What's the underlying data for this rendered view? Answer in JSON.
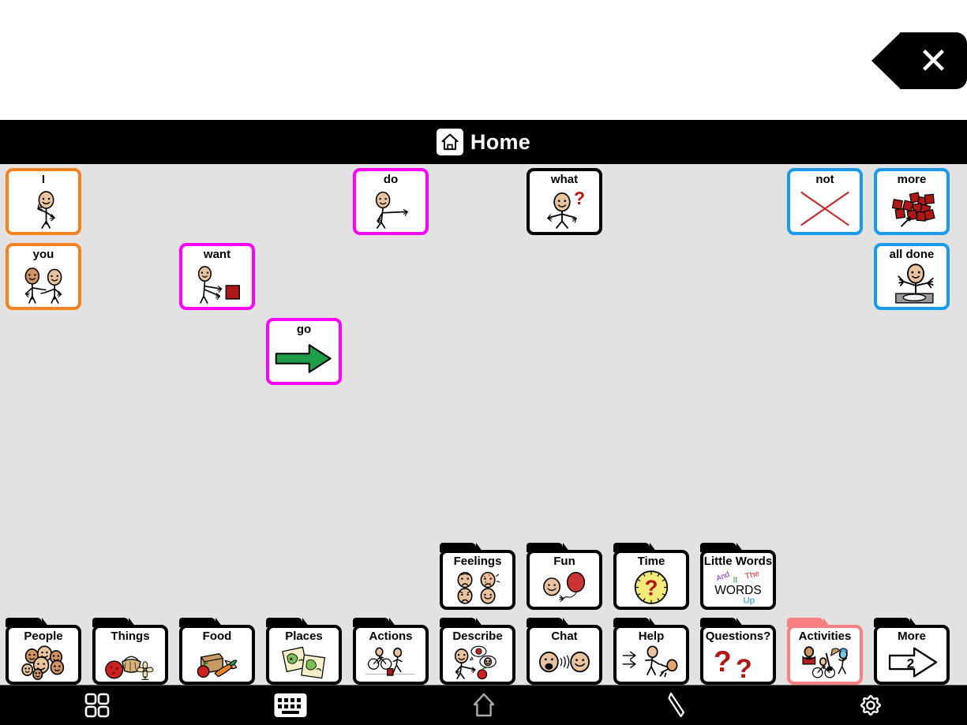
{
  "app": {
    "sentence_bar_text": "",
    "clear_button_label": "✕",
    "clear_button_icon": "close-x-icon"
  },
  "header": {
    "title": "Home",
    "icon": "home-icon"
  },
  "colors": {
    "board_background": "#e2e2e2",
    "header_background": "#000000",
    "pronoun_border": "#f58220",
    "verb_border": "#ff00ff",
    "question_border": "#000000",
    "negation_border": "#1a9ae8",
    "category_border": "#000000",
    "selected_border": "#f98080",
    "skin": "#e8c39e",
    "red": "#b01818",
    "green": "#1f9c4a"
  },
  "board": {
    "columns": 11,
    "rows": 7,
    "words": [
      {
        "label": "I",
        "col": 0,
        "row": 0,
        "color": "#f58220",
        "fold": true,
        "icon": "person-pointing-self-icon"
      },
      {
        "label": "you",
        "col": 0,
        "row": 1,
        "color": "#f58220",
        "fold": true,
        "icon": "two-people-pointing-icon"
      },
      {
        "label": "do",
        "col": 4,
        "row": 0,
        "color": "#ff00ff",
        "fold": true,
        "icon": "person-reaching-icon"
      },
      {
        "label": "want",
        "col": 2,
        "row": 1,
        "color": "#ff00ff",
        "fold": true,
        "icon": "person-reaching-for-object-icon"
      },
      {
        "label": "go",
        "col": 3,
        "row": 2,
        "color": "#ff00ff",
        "fold": true,
        "icon": "green-arrow-right-icon"
      },
      {
        "label": "what",
        "col": 6,
        "row": 0,
        "color": "#000000",
        "fold": false,
        "icon": "person-question-icon"
      },
      {
        "label": "not",
        "col": 9,
        "row": 0,
        "color": "#1a9ae8",
        "fold": false,
        "icon": "red-x-icon"
      },
      {
        "label": "more",
        "col": 10,
        "row": 0,
        "color": "#1a9ae8",
        "fold": false,
        "icon": "red-blocks-pile-icon"
      },
      {
        "label": "all done",
        "col": 10,
        "row": 1,
        "color": "#1a9ae8",
        "fold": false,
        "icon": "person-hands-up-empty-plate-icon"
      }
    ],
    "categories": [
      {
        "label": "Feelings",
        "col": 5,
        "row": 5,
        "icon": "four-faces-icon",
        "selected": false
      },
      {
        "label": "Fun",
        "col": 6,
        "row": 5,
        "icon": "face-balloon-icon",
        "selected": false
      },
      {
        "label": "Time",
        "col": 7,
        "row": 5,
        "icon": "clock-question-icon",
        "selected": false
      },
      {
        "label": "Little Words",
        "col": 8,
        "row": 5,
        "icon": "little-words-icon",
        "selected": false
      },
      {
        "label": "People",
        "col": 0,
        "row": 6,
        "icon": "group-of-faces-icon",
        "selected": false
      },
      {
        "label": "Things",
        "col": 1,
        "row": 6,
        "icon": "ball-basket-fan-icon",
        "selected": false
      },
      {
        "label": "Food",
        "col": 2,
        "row": 6,
        "icon": "bread-apple-carrot-icon",
        "selected": false
      },
      {
        "label": "Places",
        "col": 3,
        "row": 6,
        "icon": "maps-icon",
        "selected": false
      },
      {
        "label": "Actions",
        "col": 4,
        "row": 6,
        "icon": "cyclist-runner-icon",
        "selected": false
      },
      {
        "label": "Describe",
        "col": 5,
        "row": 6,
        "icon": "person-describing-icon",
        "selected": false
      },
      {
        "label": "Chat",
        "col": 6,
        "row": 6,
        "icon": "two-faces-talking-icon",
        "selected": false
      },
      {
        "label": "Help",
        "col": 7,
        "row": 6,
        "icon": "helping-hands-icon",
        "selected": false
      },
      {
        "label": "Questions?",
        "col": 8,
        "row": 6,
        "icon": "two-question-marks-icon",
        "selected": false
      },
      {
        "label": "Activities",
        "col": 9,
        "row": 6,
        "icon": "activities-icon",
        "selected": true
      },
      {
        "label": "More",
        "col": 10,
        "row": 6,
        "icon": "arrow-right-page-icon",
        "selected": false,
        "badge": "2"
      }
    ],
    "little_words_art": {
      "and": "And",
      "it": "It",
      "the": "The",
      "words": "WORDS",
      "up": "Up",
      "and_color": "#7a2fbf",
      "it_color": "#2e9e4a",
      "the_color": "#e03030",
      "words_color": "#000000",
      "up_color": "#1f8fb5"
    },
    "more_badge": "2"
  },
  "toolbar": {
    "items": [
      {
        "name": "grid-icon",
        "label": "Grid"
      },
      {
        "name": "keyboard-icon",
        "label": "Keyboard"
      },
      {
        "name": "home-icon",
        "label": "Home"
      },
      {
        "name": "pencil-icon",
        "label": "Edit"
      },
      {
        "name": "gear-icon",
        "label": "Settings"
      }
    ]
  }
}
